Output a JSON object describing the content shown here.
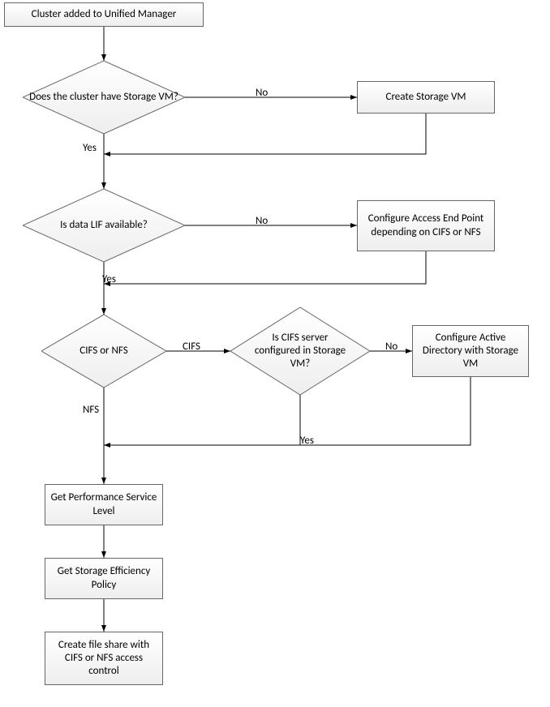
{
  "title": "Cluster added to Unified Manager",
  "nodes": {
    "start": "Cluster added to Unified Manager",
    "d1": "Does the cluster have Storage VM?",
    "b1": "Create Storage VM",
    "d2": "Is data LIF available?",
    "b2": "Configure Access End Point depending on CIFS or NFS",
    "d3": "CIFS or NFS",
    "d4": "Is CIFS server configured in Storage VM?",
    "b3": "Configure Active Directory with Storage VM",
    "b4": "Get Performance Service Level",
    "b5": "Get Storage Efficiency Policy",
    "b6": "Create file share with CIFS or NFS access control"
  },
  "labels": {
    "no": "No",
    "yes": "Yes",
    "cifs": "CIFS",
    "nfs": "NFS"
  },
  "chart_data": {
    "type": "flowchart",
    "nodes": [
      {
        "id": "start",
        "type": "process",
        "text": "Cluster added to Unified Manager"
      },
      {
        "id": "d1",
        "type": "decision",
        "text": "Does the cluster have Storage VM?"
      },
      {
        "id": "b1",
        "type": "process",
        "text": "Create Storage VM"
      },
      {
        "id": "d2",
        "type": "decision",
        "text": "Is data LIF available?"
      },
      {
        "id": "b2",
        "type": "process",
        "text": "Configure Access End Point depending on CIFS or NFS"
      },
      {
        "id": "d3",
        "type": "decision",
        "text": "CIFS or NFS"
      },
      {
        "id": "d4",
        "type": "decision",
        "text": "Is CIFS server configured in Storage VM?"
      },
      {
        "id": "b3",
        "type": "process",
        "text": "Configure Active Directory with Storage VM"
      },
      {
        "id": "b4",
        "type": "process",
        "text": "Get Performance Service Level"
      },
      {
        "id": "b5",
        "type": "process",
        "text": "Get Storage Efficiency Policy"
      },
      {
        "id": "b6",
        "type": "process",
        "text": "Create file share with CIFS or NFS access control"
      }
    ],
    "edges": [
      {
        "from": "start",
        "to": "d1"
      },
      {
        "from": "d1",
        "to": "b1",
        "label": "No"
      },
      {
        "from": "d1",
        "to": "d2",
        "label": "Yes"
      },
      {
        "from": "b1",
        "to": "d2"
      },
      {
        "from": "d2",
        "to": "b2",
        "label": "No"
      },
      {
        "from": "d2",
        "to": "d3",
        "label": "Yes"
      },
      {
        "from": "b2",
        "to": "d3"
      },
      {
        "from": "d3",
        "to": "d4",
        "label": "CIFS"
      },
      {
        "from": "d3",
        "to": "b4",
        "label": "NFS"
      },
      {
        "from": "d4",
        "to": "b3",
        "label": "No"
      },
      {
        "from": "d4",
        "to": "b4",
        "label": "Yes"
      },
      {
        "from": "b3",
        "to": "b4"
      },
      {
        "from": "b4",
        "to": "b5"
      },
      {
        "from": "b5",
        "to": "b6"
      }
    ]
  }
}
